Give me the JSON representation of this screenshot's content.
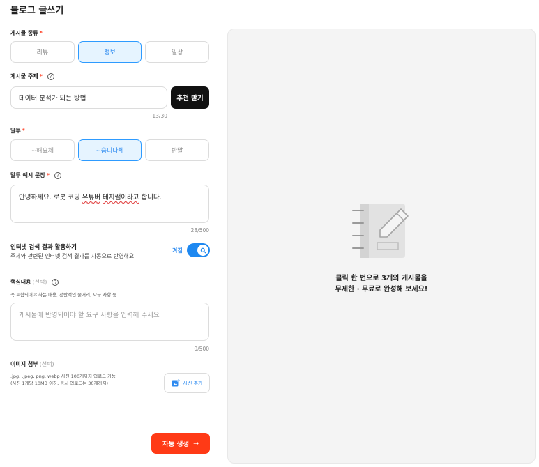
{
  "page": {
    "title": "블로그 글쓰기"
  },
  "post_type": {
    "label": "게시물 종류",
    "required_mark": "*",
    "options": [
      "리뷰",
      "정보",
      "일상"
    ],
    "selected": "정보"
  },
  "topic": {
    "label": "게시물 주제",
    "required_mark": "*",
    "help_icon": "?",
    "value": "데이터 분석가 되는 방법",
    "counter": "13/30",
    "recommend_button": "추천 받기"
  },
  "tone": {
    "label": "말투",
    "required_mark": "*",
    "options": [
      "~해요체",
      "~습니다체",
      "반말"
    ],
    "selected": "~습니다체"
  },
  "tone_example": {
    "label": "말투 예시 문장",
    "required_mark": "*",
    "help_icon": "?",
    "value_before": "안녕하세요. 로봇 코딩 ",
    "value_spell1": "유튜버",
    "value_space": " ",
    "value_spell2": "테지쌤이라고",
    "value_after": " 합니다.",
    "counter": "28/500"
  },
  "web_search": {
    "title": "인터넷 검색 결과 활용하기",
    "description": "주제와 관련된 인터넷 검색 결과를 자동으로 반영해요",
    "state_label": "켜짐",
    "enabled": true
  },
  "key_content": {
    "label": "핵심내용",
    "optional": "(선택)",
    "help_icon": "?",
    "description": "꼭 포함되어야 하는 내용, 전반적인 줄거리, 요구 사항 등",
    "placeholder": "게시물에 반영되어야 할 요구 사항을 입력해 주세요",
    "counter": "0/500"
  },
  "image_attach": {
    "label": "이미지 첨부",
    "optional": "(선택)",
    "desc_line1": ".jpg, .jpeg, png, webp 사진 100개까지 업로드 가능",
    "desc_line2": "(사진 1개당 10MB 이하, 동시 업로드는 30개까지)",
    "button": "사진 추가"
  },
  "generate": {
    "label": "자동 생성",
    "arrow": "→"
  },
  "preview": {
    "line1": "클릭 한 번으로 3개의 게시물을",
    "line2": "무제한 · 무료로 완성해 보세요!"
  },
  "colors": {
    "accent_blue": "#2e8bf0",
    "accent_orange": "#ff3a16"
  }
}
